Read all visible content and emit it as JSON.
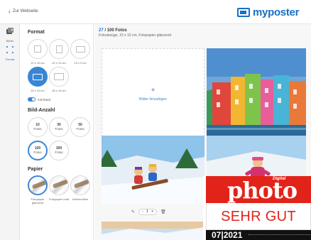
{
  "header": {
    "back_label": "Zur Webseite",
    "logo_text": "myposter",
    "brand_color": "#1a6fc4"
  },
  "rail": {
    "items": [
      {
        "label": "Bilder",
        "icon": "images-icon"
      },
      {
        "label": "Format",
        "icon": "crop-icon"
      }
    ]
  },
  "sidebar": {
    "format": {
      "title": "Format",
      "options": [
        {
          "label": "10 x 10 cm",
          "icon": "square-frame-icon"
        },
        {
          "label": "10 x 12 cm",
          "icon": "portrait-frame-icon"
        },
        {
          "label": "13 x 9 cm",
          "icon": "landscape-frame-icon"
        },
        {
          "label": "15 x 10 cm",
          "icon": "landscape-frame-icon",
          "selected": true
        },
        {
          "label": "18 x 13 cm",
          "icon": "landscape-frame-icon"
        }
      ],
      "border_toggle_label": "mit Rand",
      "border_toggle_on": true
    },
    "quantity": {
      "title": "Bild-Anzahl",
      "options": [
        {
          "number": "10",
          "unit": "Fotos"
        },
        {
          "number": "30",
          "unit": "Fotos"
        },
        {
          "number": "50",
          "unit": "Fotos"
        },
        {
          "number": "100",
          "unit": "Fotos",
          "selected": true
        },
        {
          "number": "300",
          "unit": "Fotos"
        }
      ]
    },
    "paper": {
      "title": "Papier",
      "options": [
        {
          "label": "Fotopapier glänzend",
          "selected": true
        },
        {
          "label": "Fotopapier matt"
        },
        {
          "label": "Hahnemühle"
        }
      ]
    }
  },
  "main": {
    "photo_count": "27",
    "photo_total": "/ 100 Fotos",
    "subinfo": "Fotoabzüge, 15 x 10 cm, Fotopapier glänzend",
    "add_label": "Bilder hinzufügen",
    "add_plus": "+",
    "photos": [
      {
        "name": "colorful-houses-photo",
        "quantity": "1"
      },
      {
        "name": "sledding-kids-photo",
        "quantity": "1"
      },
      {
        "name": "child-in-snow-photo",
        "quantity": ""
      },
      {
        "name": "snow-landscape-photo",
        "quantity": ""
      }
    ],
    "qty_minus": "-",
    "qty_plus": "+"
  },
  "badge": {
    "digital": "Digital",
    "brand": "photo",
    "rating": "SEHR GUT",
    "issue": "07|2021",
    "color": "#e2231a"
  }
}
